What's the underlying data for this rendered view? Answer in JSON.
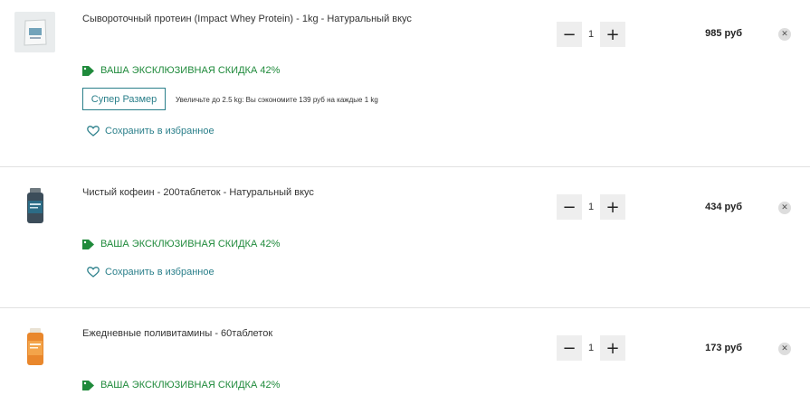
{
  "cart": {
    "items": [
      {
        "title": "Сывороточный протеин (Impact Whey Protein) - 1kg - Натуральный вкус",
        "quantity": "1",
        "price": "985 руб",
        "discount": "ВАША ЭКСКЛЮЗИВНАЯ СКИДКА 42%",
        "upsell_button": "Супер Размер",
        "upsell_text": "Увеличьте до 2.5 kg: Вы сэкономите 139 руб на каждые 1 kg",
        "favorite": "Сохранить в избранное"
      },
      {
        "title": "Чистый кофеин - 200таблеток - Натуральный вкус",
        "quantity": "1",
        "price": "434 руб",
        "discount": "ВАША ЭКСКЛЮЗИВНАЯ СКИДКА 42%",
        "favorite": "Сохранить в избранное"
      },
      {
        "title": "Ежедневные поливитамины - 60таблеток",
        "quantity": "1",
        "price": "173 руб",
        "discount": "ВАША ЭКСКЛЮЗИВНАЯ СКИДКА 42%"
      }
    ],
    "controls": {
      "minus": "−",
      "plus": "+",
      "remove": "✕"
    }
  },
  "colors": {
    "discount": "#1f8a3b",
    "accent": "#2a7f8a",
    "qty_bg": "#eeeeee"
  },
  "icons": {
    "discount": "tag-icon",
    "favorite": "heart-icon",
    "remove": "close-icon"
  }
}
